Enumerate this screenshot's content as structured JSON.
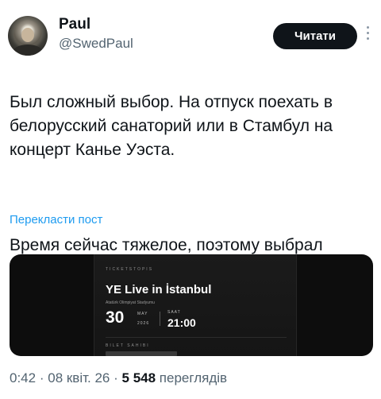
{
  "author": {
    "name": "Paul",
    "handle": "@SwedPaul",
    "follow_label": "Читати"
  },
  "tweet": {
    "paragraph_1": "Был сложный выбор. На отпуск поехать в\nбелорусский санаторий или в Стамбул на\nконцерт Канье Уэста.",
    "paragraph_2": "Время сейчас тяжелое, поэтому выбрал\nболее бюджетный вариант:",
    "translate_label": "Перекласти пост"
  },
  "media": {
    "brand": "TICKETSTOPIS",
    "event_title": "YE Live in İstanbul",
    "venue": "Atatürk Olimpiyat Stadyumu",
    "day": "30",
    "month": "MAY",
    "year": "2026",
    "time_label": "SAAT",
    "time": "21:00",
    "ticket_owner_label": "BILET SAHIBI"
  },
  "meta": {
    "time": "0:42",
    "date": "08 квіт. 26",
    "separator": "·",
    "views_count": "5 548",
    "views_label": "переглядів"
  }
}
